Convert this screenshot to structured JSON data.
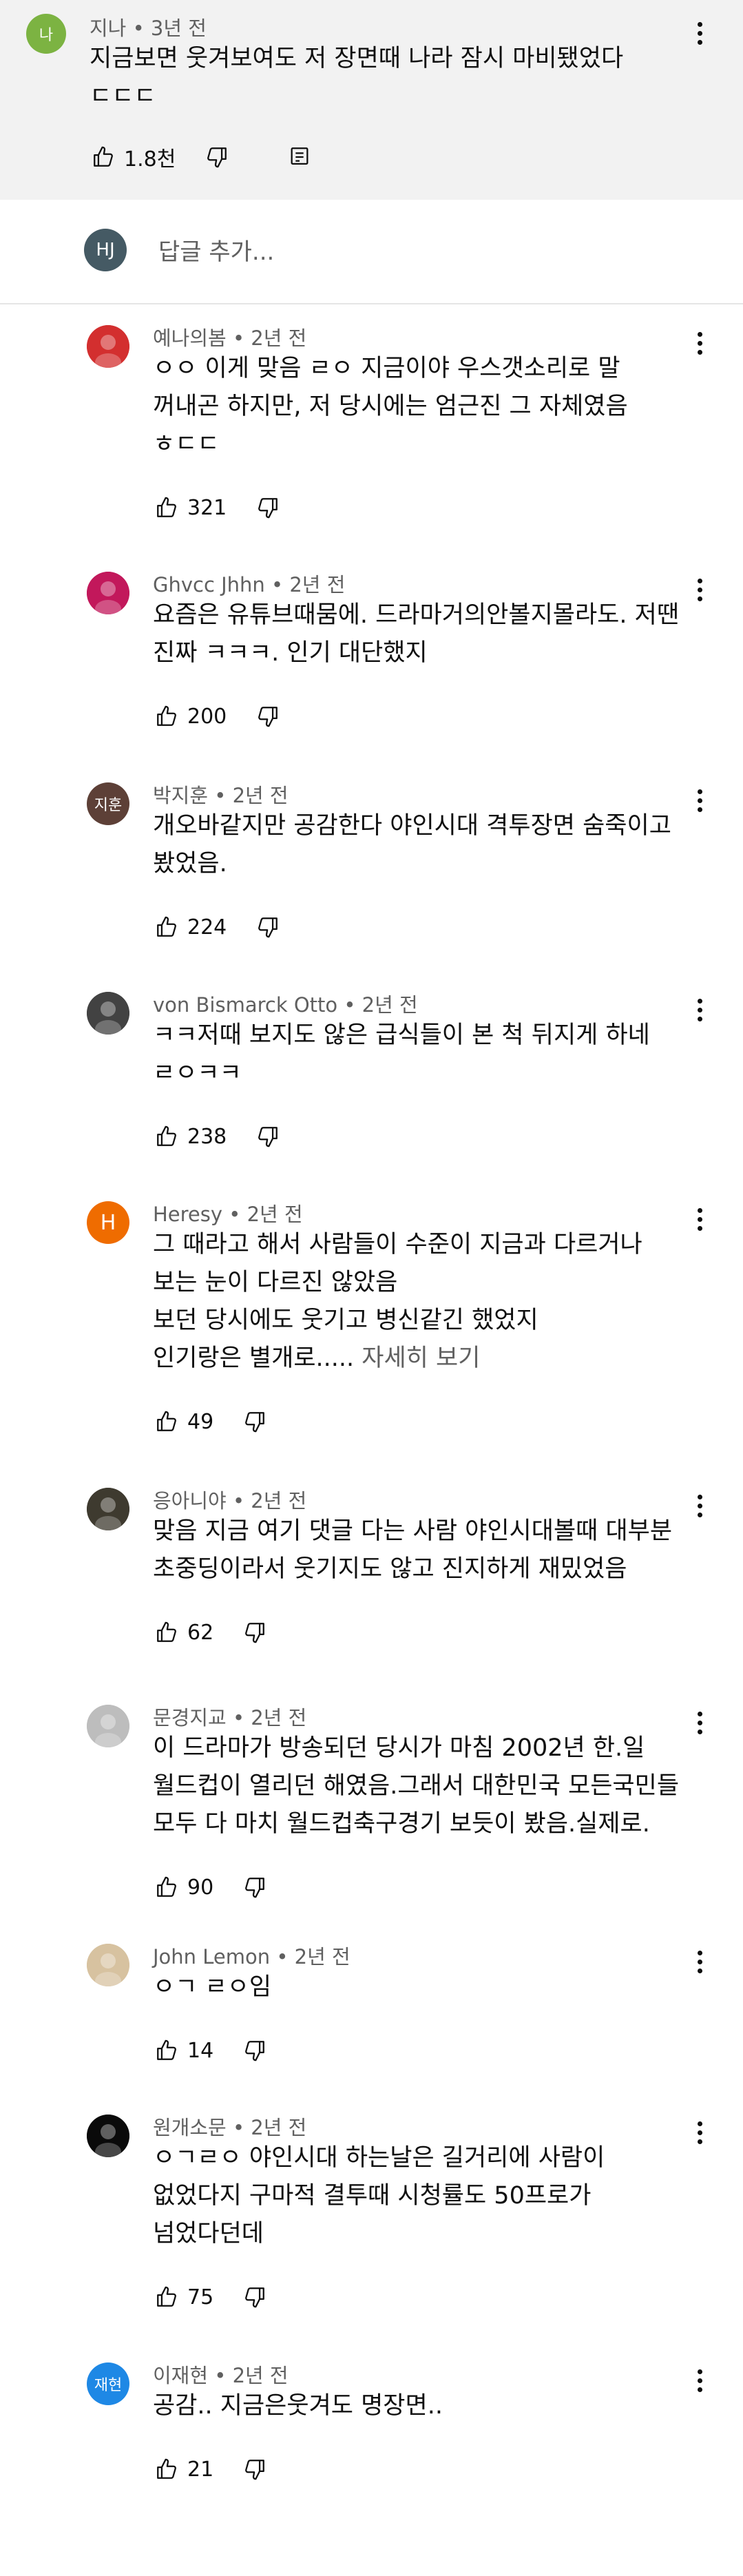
{
  "parent": {
    "avatar_initials": "나",
    "avatar_color": "#7cb342",
    "meta": "지나 • 3년 전",
    "text": "지금보면 웃겨보여도 저 장면때 나라 잠시 마비됐었다\nㄷㄷㄷ",
    "likes": "1.8천"
  },
  "reply": {
    "avatar_initials": "HJ",
    "avatar_color": "#455a64",
    "placeholder": "답글 추가..."
  },
  "comments": [
    {
      "meta": "예나의봄 • 2년 전",
      "text": "ㅇㅇ 이게 맞음 ㄹㅇ 지금이야 우스갯소리로 말\n꺼내곤 하지만, 저 당시에는 엄근진 그 자체였음\nㅎㄷㄷ",
      "likes": "321",
      "avatar_type": "photo",
      "avatar_color": "#d32f2f",
      "avatar_initials": ""
    },
    {
      "meta": "Ghvcc Jhhn • 2년 전",
      "text": "요즘은 유튜브때뭄에. 드라마거의안볼지몰라도. 저땐\n진짜 ㅋㅋㅋ. 인기 대단했지",
      "likes": "200",
      "avatar_type": "photo",
      "avatar_color": "#c2185b",
      "avatar_initials": ""
    },
    {
      "meta": "박지훈 • 2년 전",
      "text": "개오바같지만 공감한다 야인시대 격투장면 숨죽이고\n봤었음.",
      "likes": "224",
      "avatar_type": "initials",
      "avatar_color": "#5d4037",
      "avatar_initials": "지훈"
    },
    {
      "meta": "von Bismarck Otto • 2년 전",
      "text": "ㅋㅋ저때 보지도 않은 급식들이 본 척 뒤지게 하네\nㄹㅇㅋㅋ",
      "likes": "238",
      "avatar_type": "photo",
      "avatar_color": "#424242",
      "avatar_initials": ""
    },
    {
      "meta": "Heresy • 2년 전",
      "text": "그 때라고 해서 사람들이 수준이 지금과 다르거나\n보는 눈이 다르진 않았음\n보던 당시에도 웃기고 병신같긴 했었지\n인기랑은 별개로..... ",
      "see_more": "자세히 보기",
      "likes": "49",
      "avatar_type": "initials",
      "avatar_color": "#ef6c00",
      "avatar_initials": "H"
    },
    {
      "meta": "응아니야 • 2년 전",
      "text": "맞음 지금 여기 댓글 다는 사람 야인시대볼때 대부분\n초중딩이라서 웃기지도 않고 진지하게 재밌었음",
      "likes": "62",
      "avatar_type": "photo",
      "avatar_color": "#3e3a2f",
      "avatar_initials": ""
    },
    {
      "meta": "문경지교 • 2년 전",
      "text": "이 드라마가 방송되던 당시가 마침 2002년 한.일\n월드컵이 열리던 해였음.그래서 대한민국 모든국민들\n모두 다 마치 월드컵축구경기 보듯이 봤음.실제로.",
      "likes": "90",
      "avatar_type": "photo",
      "avatar_color": "#bdbdbd",
      "avatar_initials": ""
    },
    {
      "meta": "John Lemon • 2년 전",
      "text": "ㅇㄱ ㄹㅇ임",
      "likes": "14",
      "avatar_type": "photo",
      "avatar_color": "#d7c2a0",
      "avatar_initials": ""
    },
    {
      "meta": "원개소문 • 2년 전",
      "text": "ㅇㄱㄹㅇ 야인시대 하는날은 길거리에 사람이\n없었다지 구마적 결투때 시청률도 50프로가\n넘었다던데",
      "likes": "75",
      "avatar_type": "photo",
      "avatar_color": "#0a0a0a",
      "avatar_initials": ""
    },
    {
      "meta": "이재현 • 2년 전",
      "text": "공감.. 지금은웃겨도 명장면..",
      "likes": "21",
      "avatar_type": "initials",
      "avatar_color": "#1e88e5",
      "avatar_initials": "재현"
    }
  ]
}
